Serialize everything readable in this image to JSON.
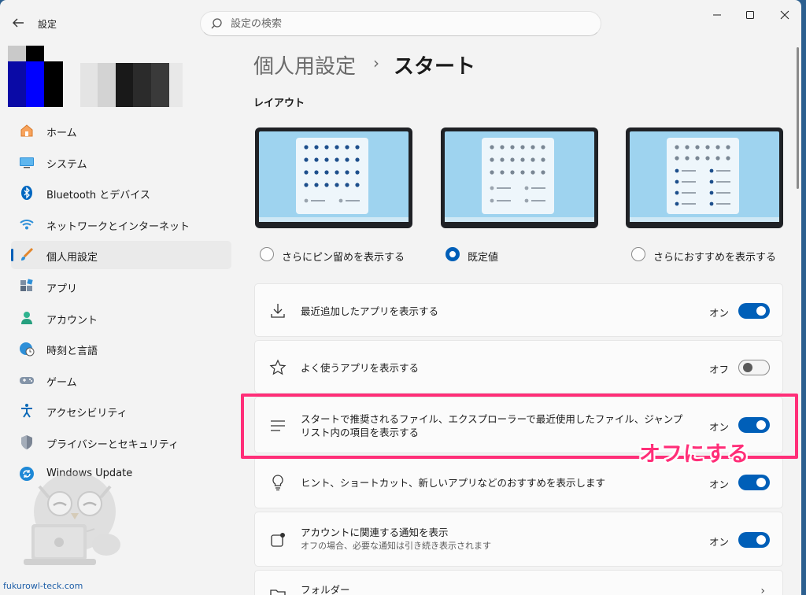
{
  "window": {
    "app_title": "設定",
    "search_placeholder": "設定の検索",
    "colors": {
      "accent": "#005fb8",
      "highlight": "#ff2e78"
    }
  },
  "sidebar": {
    "items": [
      {
        "label": "ホーム",
        "icon": "home-icon"
      },
      {
        "label": "システム",
        "icon": "monitor-icon"
      },
      {
        "label": "Bluetooth とデバイス",
        "icon": "bluetooth-icon"
      },
      {
        "label": "ネットワークとインターネット",
        "icon": "wifi-icon"
      },
      {
        "label": "個人用設定",
        "icon": "brush-icon",
        "active": true
      },
      {
        "label": "アプリ",
        "icon": "apps-icon"
      },
      {
        "label": "アカウント",
        "icon": "person-icon"
      },
      {
        "label": "時刻と言語",
        "icon": "globe-clock-icon"
      },
      {
        "label": "ゲーム",
        "icon": "gamepad-icon"
      },
      {
        "label": "アクセシビリティ",
        "icon": "accessibility-icon"
      },
      {
        "label": "プライバシーとセキュリティ",
        "icon": "shield-icon"
      },
      {
        "label": "Windows Update",
        "icon": "update-icon"
      }
    ]
  },
  "breadcrumb": {
    "parent": "個人用設定",
    "separator": "›",
    "current": "スタート"
  },
  "layout_section": {
    "heading": "レイアウト",
    "options": [
      {
        "label": "さらにピン留めを表示する",
        "selected": false
      },
      {
        "label": "既定値",
        "selected": true
      },
      {
        "label": "さらにおすすめを表示する",
        "selected": false
      }
    ]
  },
  "settings": [
    {
      "label": "最近追加したアプリを表示する",
      "state": "オン",
      "on": true,
      "icon": "download-icon"
    },
    {
      "label": "よく使うアプリを表示する",
      "state": "オフ",
      "on": false,
      "icon": "star-icon"
    },
    {
      "label": "スタートで推奨されるファイル、エクスプローラーで最近使用したファイル、ジャンプ リスト内の項目を表示する",
      "state": "オン",
      "on": true,
      "icon": "list-icon"
    },
    {
      "label": "ヒント、ショートカット、新しいアプリなどのおすすめを表示します",
      "state": "オン",
      "on": true,
      "icon": "lightbulb-icon"
    },
    {
      "label": "アカウントに関連する通知を表示",
      "sub": "オフの場合、必要な通知は引き続き表示されます",
      "state": "オン",
      "on": true,
      "icon": "account-notification-icon"
    },
    {
      "label": "フォルダー",
      "icon": "folder-icon",
      "chevron": "›"
    }
  ],
  "annotation": {
    "text": "オフにする"
  },
  "watermark": "fukurowl-teck.com"
}
